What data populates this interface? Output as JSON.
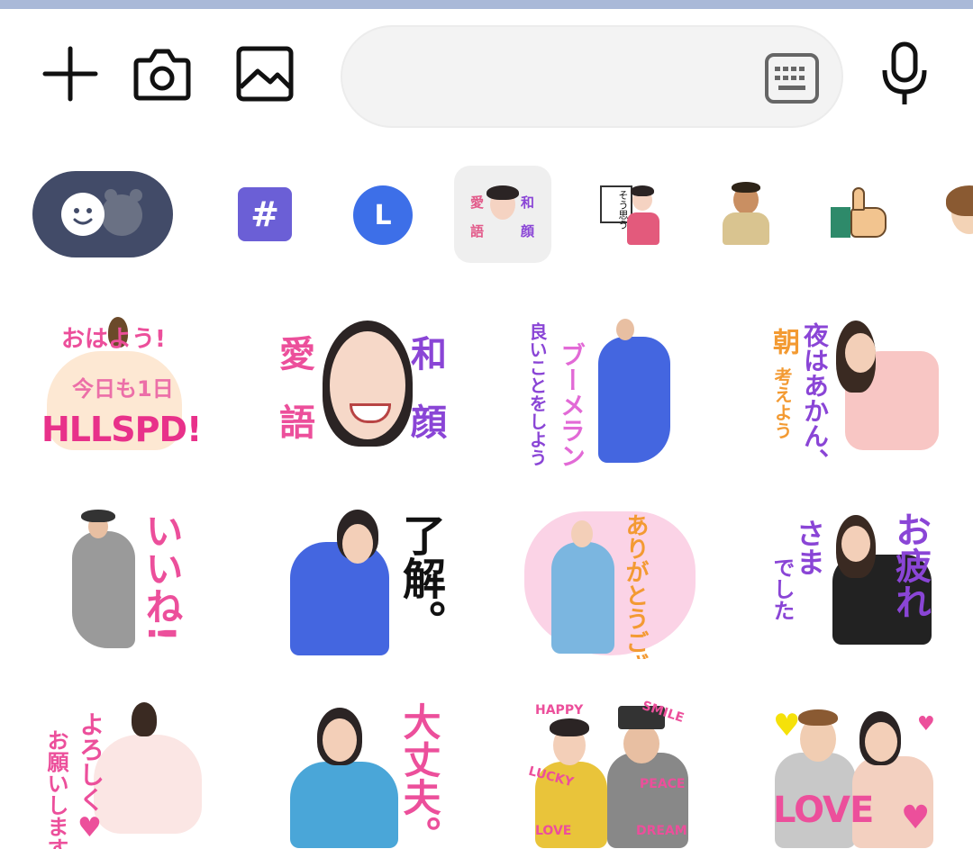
{
  "colors": {
    "top_strip": "#a9b9d8",
    "icon": "#111111",
    "emoji_tab": "#424b68",
    "hash_tab": "#6b5fd6",
    "l_tab": "#3d6fe8",
    "selected_tab_bg": "#efefef",
    "pink": "#ec4f9b",
    "purple": "#8a45d6",
    "orange": "#f39a32",
    "blue_dress": "#4466e0"
  },
  "input_bar": {
    "plus_icon": "plus-icon",
    "camera_icon": "camera-icon",
    "gallery_icon": "image-icon",
    "message_placeholder": "",
    "keyboard_icon": "keyboard-icon",
    "mic_icon": "microphone-icon"
  },
  "tabs": {
    "hash_label": "#",
    "l_label": "L",
    "selected_pack": {
      "chars": [
        "愛",
        "和",
        "語",
        "顔"
      ]
    },
    "sign_pack_text": "そう思う"
  },
  "stickers": [
    {
      "lines": [
        "おはよう!",
        "今日も1日",
        "HLLSPD!"
      ]
    },
    {
      "chars": [
        "愛",
        "和",
        "語",
        "顔"
      ]
    },
    {
      "left": "良いことをしよう",
      "right": "ブーメラン"
    },
    {
      "col1": "朝",
      "col2": "夜はあかん、",
      "col3": "考えよう"
    },
    {
      "text": "いいね!"
    },
    {
      "text": "了解。"
    },
    {
      "text": "ありがとうございます!"
    },
    {
      "col1": "さま",
      "col2": "でした",
      "col3": "お疲れ"
    },
    {
      "col1": "よろしく",
      "col2": "お願いします"
    },
    {
      "text": "大丈夫。"
    },
    {
      "words": [
        "HAPPY",
        "SMILE",
        "LUCKY",
        "PEACE",
        "LOVE",
        "DREAM"
      ]
    },
    {
      "text": "LOVE"
    }
  ]
}
